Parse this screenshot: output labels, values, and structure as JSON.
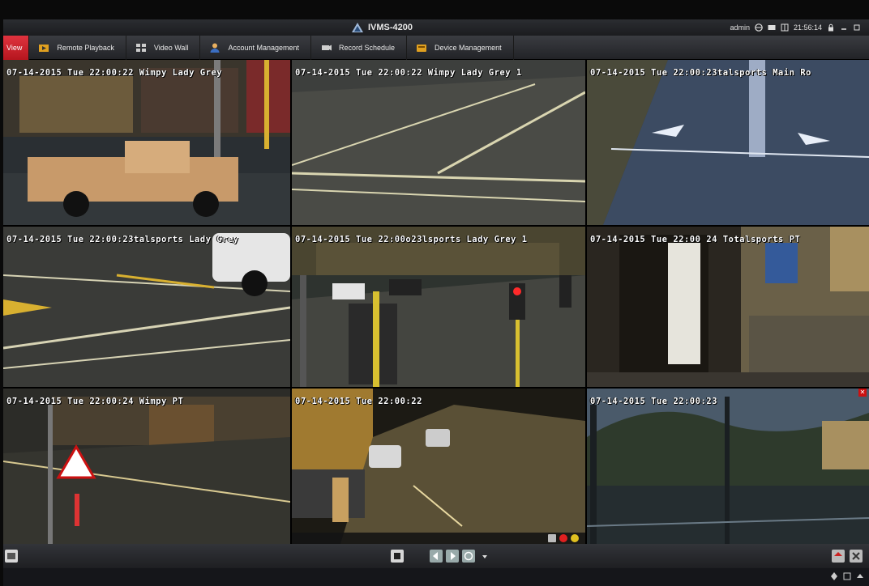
{
  "window": {
    "title": "IVMS-4200",
    "user": "admin",
    "clock": "21:56:14"
  },
  "menu": {
    "items": [
      {
        "label": "View",
        "icon": "view-icon",
        "active": true
      },
      {
        "label": "Remote Playback",
        "icon": "playback-icon",
        "active": false
      },
      {
        "label": "Video Wall",
        "icon": "video-wall-icon",
        "active": false
      },
      {
        "label": "Account Management",
        "icon": "account-icon",
        "active": false
      },
      {
        "label": "Record Schedule",
        "icon": "record-schedule-icon",
        "active": false
      },
      {
        "label": "Device Management",
        "icon": "device-icon",
        "active": false
      }
    ]
  },
  "cameras": [
    {
      "osd": "07-14-2015 Tue 22:00:22  Wimpy Lady Grey"
    },
    {
      "osd": "07-14-2015 Tue 22:00:22  Wimpy Lady Grey 1"
    },
    {
      "osd": "07-14-2015 Tue 22:00:23talsports Main Ro"
    },
    {
      "osd": "07-14-2015 Tue 22:00:23talsports Lady Grey"
    },
    {
      "osd": "07-14-2015 Tue 22:00o23lsports Lady Grey 1"
    },
    {
      "osd": "07-14-2015 Tue 22:00 24   Totalsports PT"
    },
    {
      "osd": "07-14-2015 Tue 22:00:24  Wimpy PT"
    },
    {
      "osd": "07-14-2015 Tue 22:00:22"
    },
    {
      "osd": "07-14-2015 Tue 22:00:23"
    }
  ],
  "selected_camera_index": 8,
  "colors": {
    "accent": "#d83040",
    "titlebar": "#1b1c1f",
    "menubar": "#2c2e33"
  }
}
